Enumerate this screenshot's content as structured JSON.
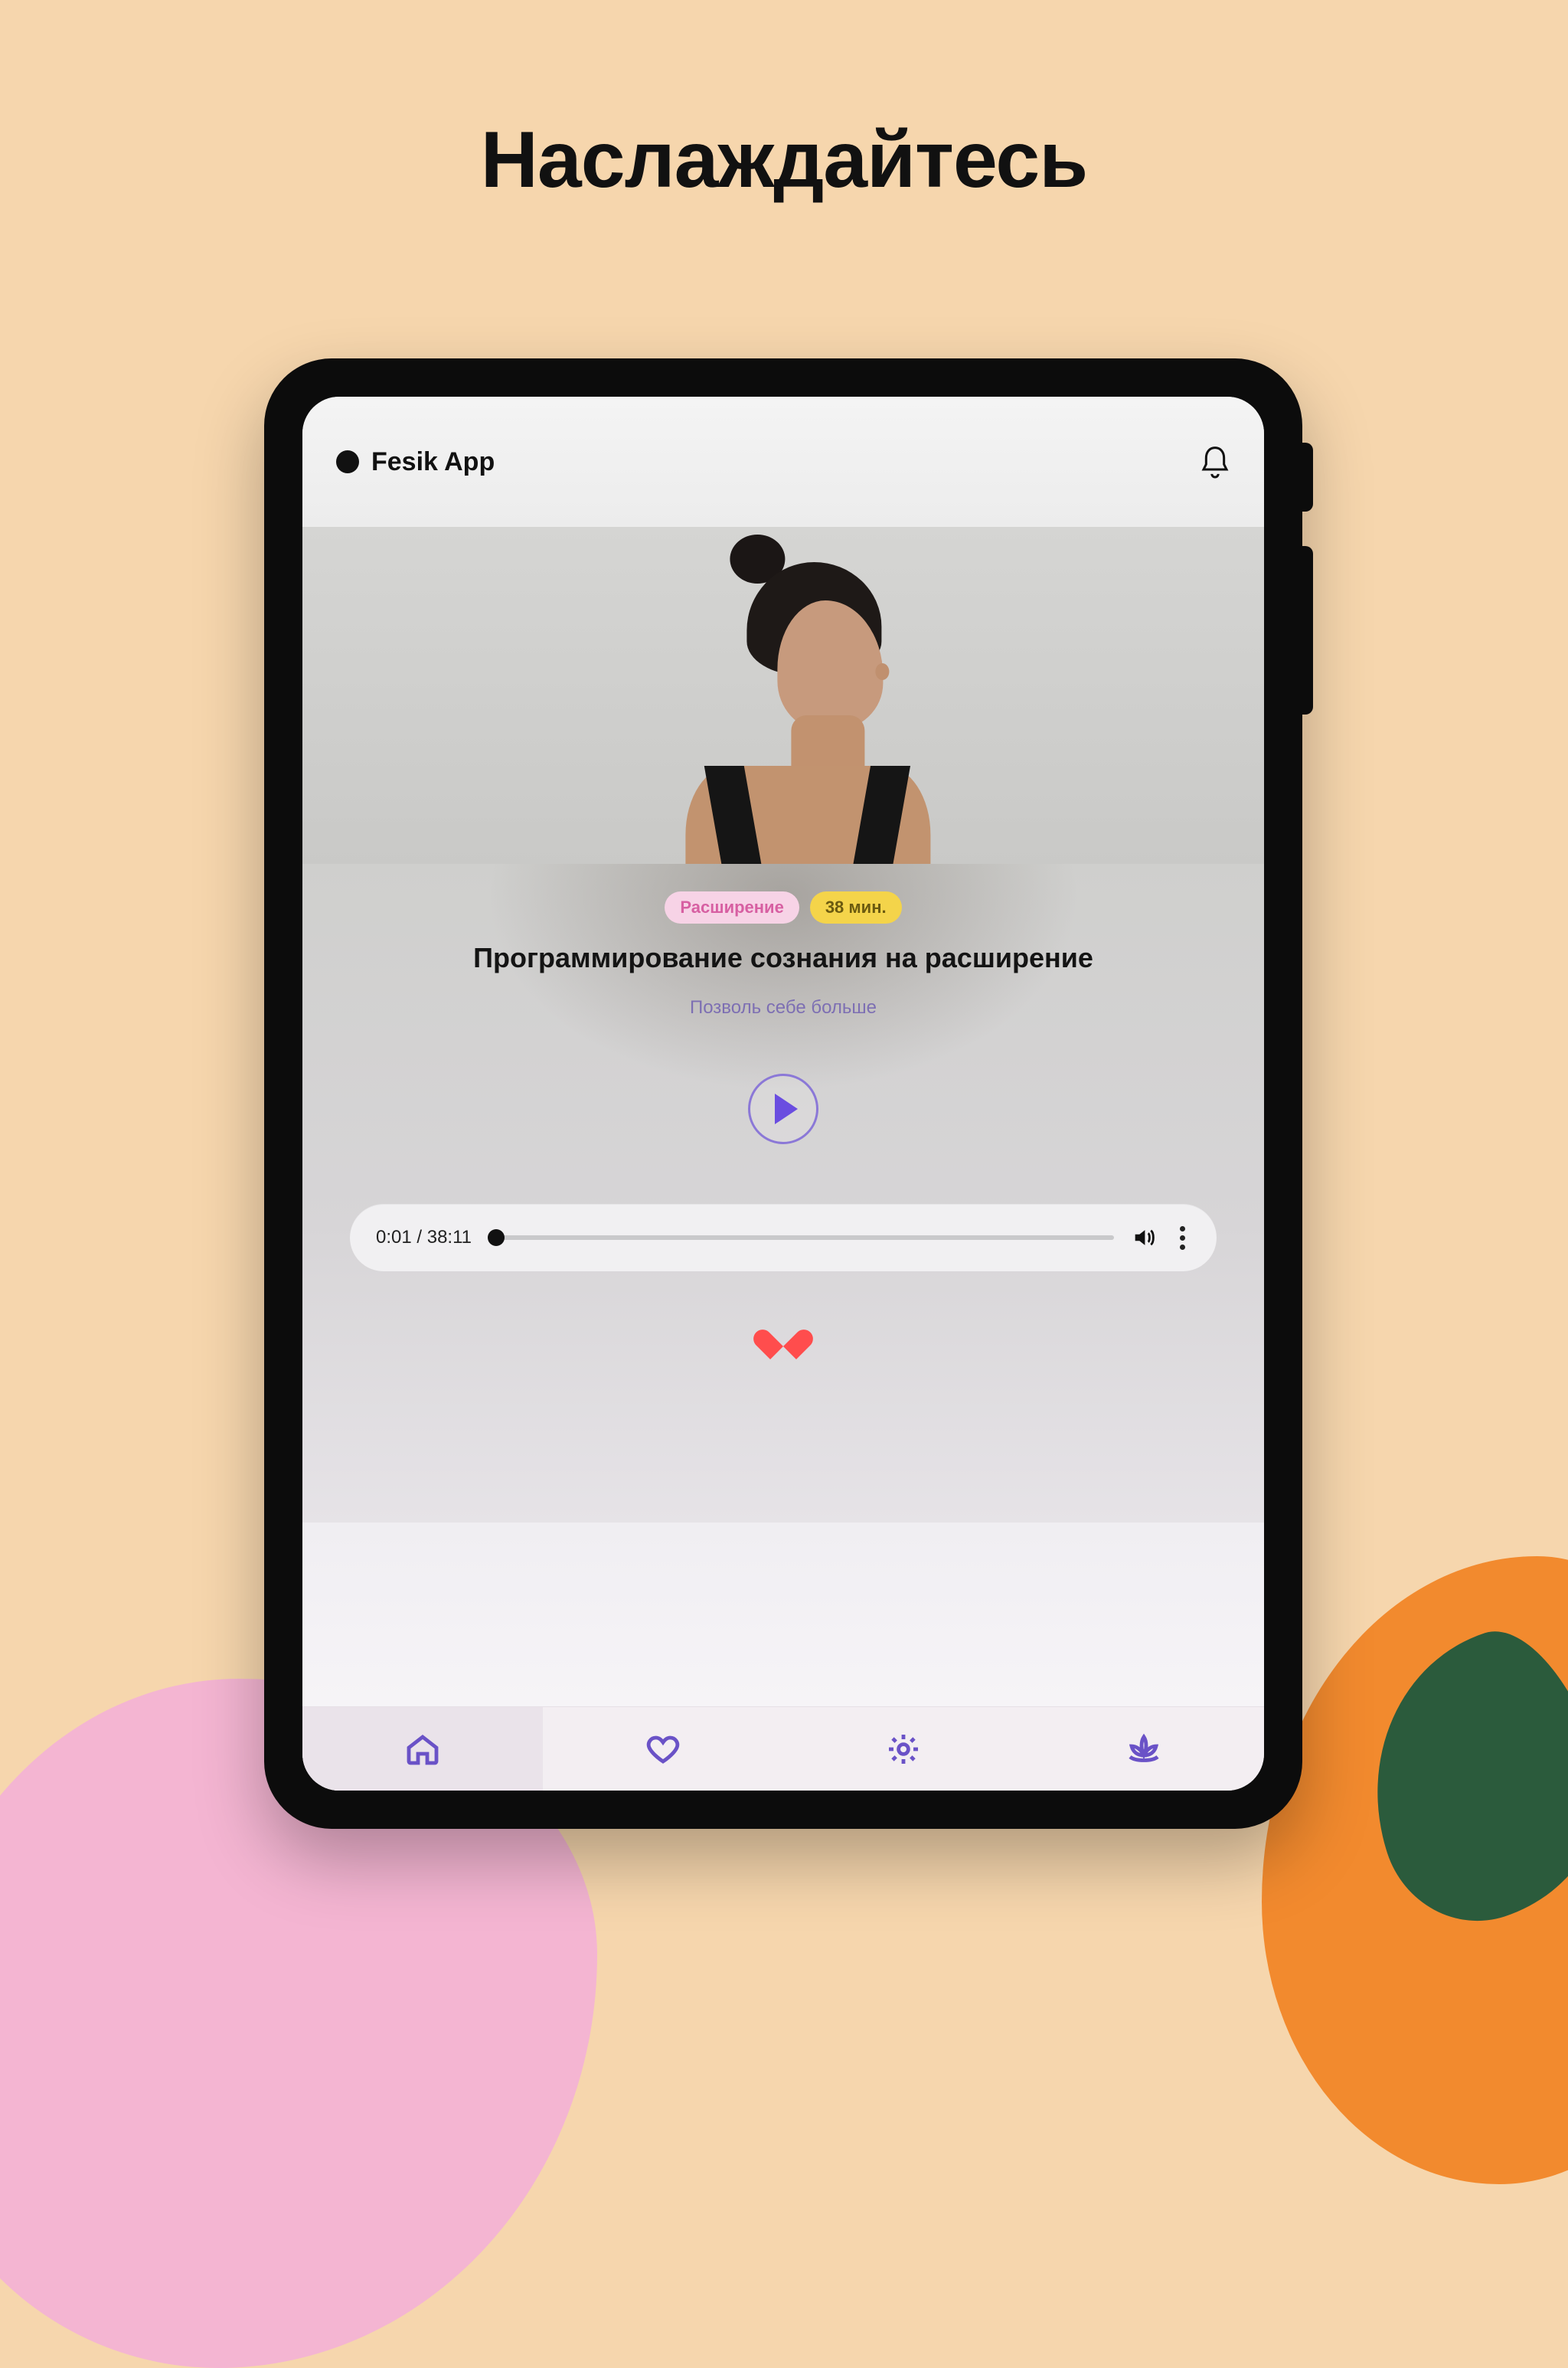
{
  "promo": {
    "headline": "Наслаждайтесь"
  },
  "app": {
    "name": "Fesik App",
    "badges": {
      "category": "Расширение",
      "duration": "38 мин."
    },
    "track": {
      "title": "Программирование сознания на расширение",
      "subtitle": "Позволь себе больше"
    },
    "player": {
      "elapsed": "0:01",
      "total": "38:11",
      "time_display": "0:01 / 38:11",
      "progress_pct": 0.04,
      "favorited": true
    },
    "tabs": [
      "home",
      "favorites",
      "settings",
      "meditate"
    ],
    "active_tab": "home"
  },
  "colors": {
    "accent": "#6a4de0",
    "accent_ring": "#8b78d7",
    "heart": "#ff4d4d"
  }
}
